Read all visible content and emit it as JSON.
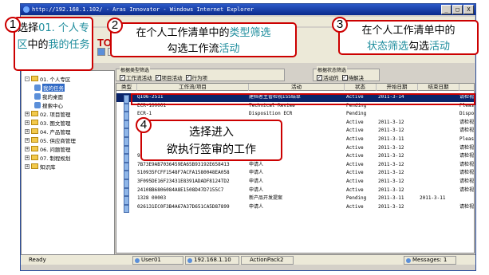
{
  "window": {
    "title": "http://192.168.1.102/ - Aras Innovator - Windows Internet Explorer",
    "min_label": "_",
    "max_label": "□",
    "close_label": "X"
  },
  "brand": "TO",
  "filters": {
    "type_group": "根据类型筛选",
    "type_items": [
      {
        "label": "工作流活动",
        "checked": true
      },
      {
        "label": "项目活动",
        "checked": true
      },
      {
        "label": "行为项",
        "checked": true
      }
    ],
    "state_group": "根据状态筛选",
    "state_items": [
      {
        "label": "活动的",
        "checked": true
      },
      {
        "label": "待解决",
        "checked": true
      }
    ]
  },
  "tree": {
    "items": [
      {
        "label": "01. 个人专区",
        "pm": "-",
        "kind": "folder",
        "level": 0
      },
      {
        "label": "我的任务",
        "kind": "leaf",
        "level": 1,
        "selected": true
      },
      {
        "label": "我的桌面",
        "kind": "leaf",
        "level": 1
      },
      {
        "label": "搜索中心",
        "kind": "leaf",
        "level": 1
      },
      {
        "label": "02. 项目管理",
        "pm": "+",
        "kind": "folder",
        "level": 0
      },
      {
        "label": "03. 图文管理",
        "pm": "+",
        "kind": "folder",
        "level": 0
      },
      {
        "label": "04. 产品管理",
        "pm": "+",
        "kind": "folder",
        "level": 0
      },
      {
        "label": "05. 供应商管理",
        "pm": "+",
        "kind": "folder",
        "level": 0
      },
      {
        "label": "06. 问题管理",
        "pm": "+",
        "kind": "folder",
        "level": 0
      },
      {
        "label": "07. 制程规划",
        "pm": "+",
        "kind": "folder",
        "level": 0
      },
      {
        "label": "知识库",
        "pm": "+",
        "kind": "folder",
        "level": 0
      }
    ]
  },
  "grid": {
    "columns": [
      "类型",
      "工作流/项目",
      "活动",
      "状态",
      "开始日期",
      "结束日期"
    ],
    "rows": [
      {
        "type": "",
        "workflow": "QIO6-2511",
        "activity": "建档者主管检视ISS结单",
        "status": "Active",
        "start": "2011-3-14",
        "end": "",
        "extra": "请检视",
        "selected": true
      },
      {
        "type": "",
        "workflow": "ECR-100001",
        "activity": "Technical Review",
        "status": "Pending",
        "start": "",
        "end": "",
        "extra": "Please"
      },
      {
        "type": "",
        "workflow": "ECR-1",
        "activity": "Disposition ECR",
        "status": "Pending",
        "start": "",
        "end": "",
        "extra": "Dispos"
      },
      {
        "type": "",
        "workflow": "",
        "activity": "",
        "status": "Active",
        "start": "2011-3-12",
        "end": "",
        "extra": "请检视"
      },
      {
        "type": "",
        "workflow": "",
        "activity": "",
        "status": "Active",
        "start": "2011-3-12",
        "end": "",
        "extra": "请检视"
      },
      {
        "type": "",
        "workflow": "",
        "activity": "",
        "status": "Active",
        "start": "2011-3-11",
        "end": "",
        "extra": "Please"
      },
      {
        "type": "",
        "workflow": "",
        "activity": "",
        "status": "Active",
        "start": "2011-3-12",
        "end": "",
        "extra": "请检视"
      },
      {
        "type": "",
        "workflow": "9108413810554293A8927590D981A32B",
        "activity": "申请人",
        "status": "Active",
        "start": "2011-3-12",
        "end": "",
        "extra": "请检视"
      },
      {
        "type": "",
        "workflow": "7B73E9AB7036459EA65B93192E658413",
        "activity": "申请人",
        "status": "Active",
        "start": "2011-3-12",
        "end": "",
        "extra": "请检视"
      },
      {
        "type": "",
        "workflow": "510935FCFF1548F7ACFA1580048EA058",
        "activity": "申请人",
        "status": "Active",
        "start": "2011-3-12",
        "end": "",
        "extra": "请检视"
      },
      {
        "type": "",
        "workflow": "3F095DE16F23431E8391ADADF8124TD2",
        "activity": "申请人",
        "status": "Active",
        "start": "2011-3-12",
        "end": "",
        "extra": "请检视"
      },
      {
        "type": "",
        "workflow": "24108B6806084A8E1508D47D7155C7",
        "activity": "申请人",
        "status": "Active",
        "start": "2011-3-12",
        "end": "",
        "extra": "请检视"
      },
      {
        "type": "",
        "workflow": "1328 00003",
        "activity": "新产品开发提案",
        "status": "Pending",
        "start": "2011-3-11",
        "end": "2011-3-11",
        "extra": ""
      },
      {
        "type": "",
        "workflow": "026131EC0F3B4A67A37D651CA5D87899",
        "activity": "申请人",
        "status": "Active",
        "start": "2011-3-12",
        "end": "",
        "extra": "请检视"
      }
    ]
  },
  "statusbar": {
    "ready": "Ready",
    "user": "User01",
    "ip": "192.168.1.10",
    "pack": "ActionPack2",
    "messages": "Messages: 1"
  },
  "callouts": {
    "c1_num": "1",
    "c1_pre": "选择",
    "c1_hl": "01. 个人专区",
    "c1_mid": "中的",
    "c1_hl2": "我的任务",
    "c2_num": "2",
    "c2_pre": "在个人工作清单中的",
    "c2_hl": "类型筛选",
    "c2_mid": "勾选工作流",
    "c2_hl2": "活动",
    "c3_num": "3",
    "c3_pre": "在个人工作清单中的",
    "c3_hl": "状态筛选",
    "c3_mid": "勾选",
    "c3_hl2": "活动",
    "c4_num": "4",
    "c4_line1": "选择进入",
    "c4_line2": "欲执行签审的工作"
  }
}
